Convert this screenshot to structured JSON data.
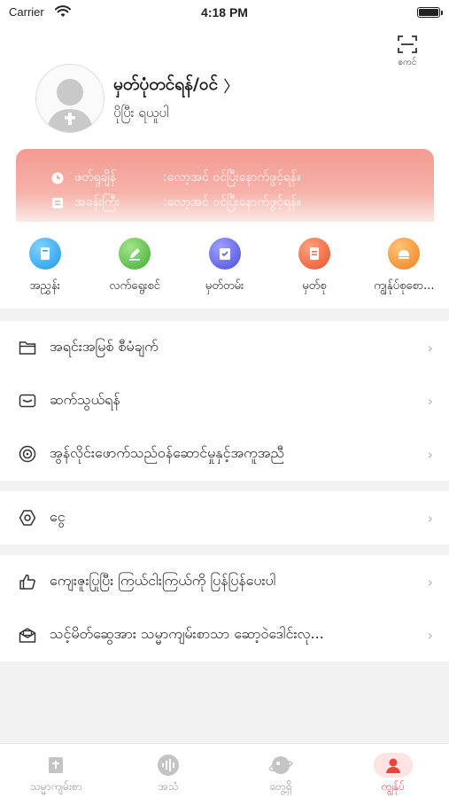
{
  "status_bar": {
    "carrier": "Carrier",
    "time": "4:18 PM"
  },
  "scan": {
    "label": "စကင်"
  },
  "profile": {
    "name": "မှတ်ပုံတင်ရန်/ဝင်",
    "chevron": "〉",
    "subtitle": "ပိုပြီး ရယူပါ"
  },
  "vip": {
    "rows": [
      {
        "key": "ဖတ်ရှုချိန်",
        "value": ":လော့အင် ဝင်ပြီးနောက်ဖွင့်ရန်။"
      },
      {
        "key": "အခန်းကြီး",
        "value": ":လော့အင် ဝင်ပြီးနောက်ဖွင့်ရန်။"
      }
    ]
  },
  "quick_actions": [
    {
      "label": "အညွှန်း",
      "color": "#29a8f0"
    },
    {
      "label": "လက်ရွေးစင်",
      "color": "#5cc146"
    },
    {
      "label": "မှတ်တမ်း",
      "color": "#5b5fe8"
    },
    {
      "label": "မှတ်စု",
      "color": "#f06a3a"
    },
    {
      "label": "ကျွန်ုပ်စုစော...",
      "color": "#f5922f"
    }
  ],
  "menu_group1": [
    {
      "label": "အရင်းအမြစ် စီမံချက်",
      "icon": "folder-icon"
    },
    {
      "label": "ဆက်သွယ်ရန်",
      "icon": "mail-icon"
    },
    {
      "label": "အွန်လိုင်းဖောက်သည်ဝန်ဆောင်မှုနှင့်အကူအညီ",
      "icon": "support-icon"
    }
  ],
  "menu_group2": [
    {
      "label": "ငွေ",
      "icon": "hexagon-settings-icon"
    }
  ],
  "menu_group3": [
    {
      "label": "ကျေးဇူးပြုပြီး ကြယ်ငါးကြယ်ကို ပြန်ပြန်ပေးပါ",
      "icon": "thumbs-up-icon"
    },
    {
      "label": "သင့်မိတ်ဆွေအား သမ္မာကျမ်းစာသာ ဆော့ဝဲဒေါင်းလု...",
      "icon": "share-mail-icon"
    }
  ],
  "tabbar": [
    {
      "label": "သမ္မာကျမ်းစာ",
      "icon": "bible-icon",
      "active": false
    },
    {
      "label": "အသံ",
      "icon": "audio-icon",
      "active": false
    },
    {
      "label": "တွေ့ရှိ",
      "icon": "discover-icon",
      "active": false
    },
    {
      "label": "ကျွန်ုပ်",
      "icon": "me-icon",
      "active": true
    }
  ],
  "colors": {
    "accent": "#e8453c",
    "vip_top": "#f39b92",
    "chevron": "#b5b5b5"
  }
}
